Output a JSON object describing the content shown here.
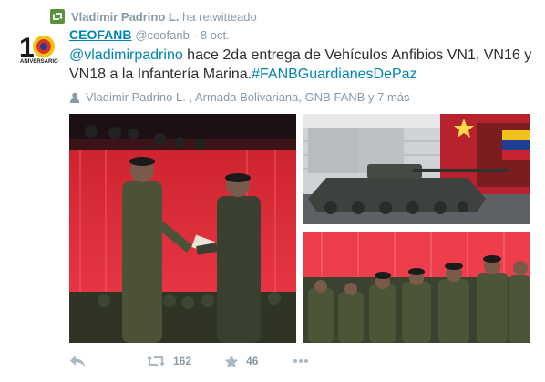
{
  "retweet": {
    "name": "Vladimir Padrino L.",
    "suffix": "ha retwitteado",
    "icon": "retweet-icon"
  },
  "tweet": {
    "author_name": "CEOFANB",
    "handle": "@ceofanb",
    "separator": "·",
    "date": "8 oct.",
    "mention": "@vladimirpadrino",
    "body": " hace 2da entrega de Vehículos Anfibios VN1, VN16 y VN18 a la Infantería Marina.",
    "hashtag": "#FANBGuardianesDePaz",
    "tagged_people": "Vladimir Padrino L. , Armada Bolivariana, GNB FANB y 7 más",
    "avatar_caption": "ANIVERSARIO"
  },
  "actions": {
    "reply_icon": "reply-icon",
    "retweet_count": "162",
    "favorite_count": "46",
    "more_icon": "more-icon"
  },
  "colors": {
    "link": "#0084b4",
    "muted": "#8899a6",
    "text": "#292f33",
    "retweet_green": "#5c913b"
  }
}
